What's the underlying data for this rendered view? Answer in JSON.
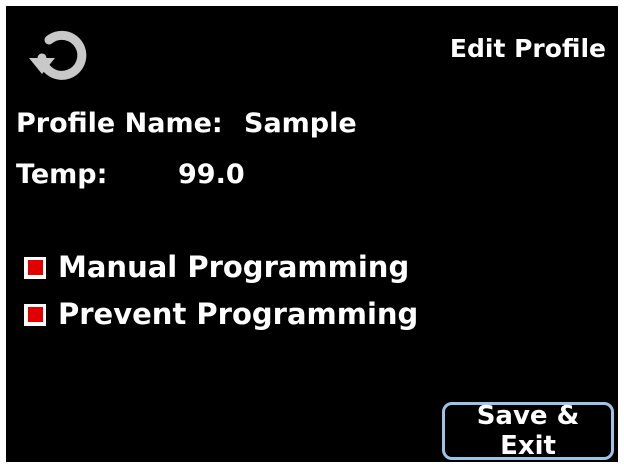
{
  "header": {
    "title": "Edit Profile",
    "back_icon": "refresh-icon"
  },
  "profile": {
    "name_label": "Profile Name:",
    "name_value": "Sample",
    "temp_label": "Temp:",
    "temp_value": "99.0"
  },
  "options": [
    {
      "label": "Manual Programming",
      "checked": true
    },
    {
      "label": "Prevent Programming",
      "checked": true
    }
  ],
  "footer": {
    "save_label": "Save & Exit"
  },
  "colors": {
    "background": "#000000",
    "text": "#ffffff",
    "checkbox_fill": "#e00000",
    "button_border": "#9ec3e6",
    "icon": "#c8c8c8"
  }
}
